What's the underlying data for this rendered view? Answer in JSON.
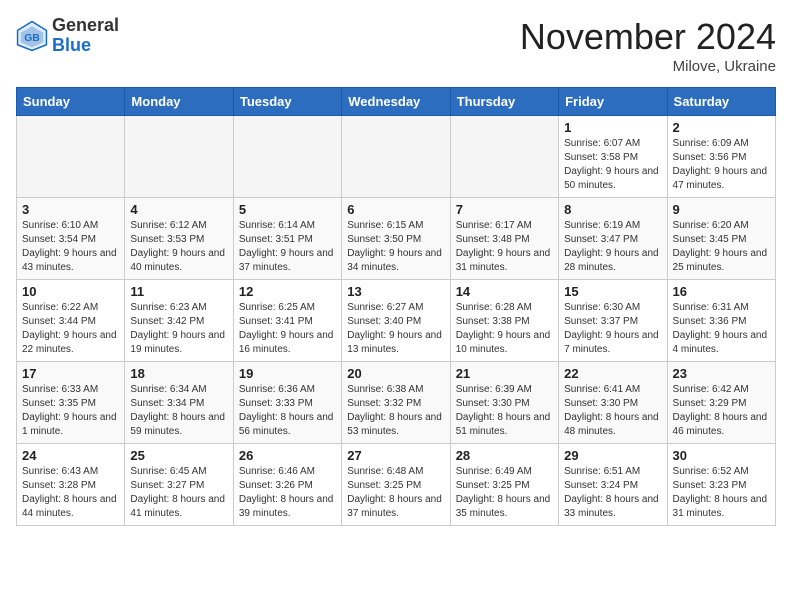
{
  "logo": {
    "general": "General",
    "blue": "Blue"
  },
  "title": "November 2024",
  "location": "Milove, Ukraine",
  "days_of_week": [
    "Sunday",
    "Monday",
    "Tuesday",
    "Wednesday",
    "Thursday",
    "Friday",
    "Saturday"
  ],
  "weeks": [
    [
      {
        "day": "",
        "info": ""
      },
      {
        "day": "",
        "info": ""
      },
      {
        "day": "",
        "info": ""
      },
      {
        "day": "",
        "info": ""
      },
      {
        "day": "",
        "info": ""
      },
      {
        "day": "1",
        "info": "Sunrise: 6:07 AM\nSunset: 3:58 PM\nDaylight: 9 hours and 50 minutes."
      },
      {
        "day": "2",
        "info": "Sunrise: 6:09 AM\nSunset: 3:56 PM\nDaylight: 9 hours and 47 minutes."
      }
    ],
    [
      {
        "day": "3",
        "info": "Sunrise: 6:10 AM\nSunset: 3:54 PM\nDaylight: 9 hours and 43 minutes."
      },
      {
        "day": "4",
        "info": "Sunrise: 6:12 AM\nSunset: 3:53 PM\nDaylight: 9 hours and 40 minutes."
      },
      {
        "day": "5",
        "info": "Sunrise: 6:14 AM\nSunset: 3:51 PM\nDaylight: 9 hours and 37 minutes."
      },
      {
        "day": "6",
        "info": "Sunrise: 6:15 AM\nSunset: 3:50 PM\nDaylight: 9 hours and 34 minutes."
      },
      {
        "day": "7",
        "info": "Sunrise: 6:17 AM\nSunset: 3:48 PM\nDaylight: 9 hours and 31 minutes."
      },
      {
        "day": "8",
        "info": "Sunrise: 6:19 AM\nSunset: 3:47 PM\nDaylight: 9 hours and 28 minutes."
      },
      {
        "day": "9",
        "info": "Sunrise: 6:20 AM\nSunset: 3:45 PM\nDaylight: 9 hours and 25 minutes."
      }
    ],
    [
      {
        "day": "10",
        "info": "Sunrise: 6:22 AM\nSunset: 3:44 PM\nDaylight: 9 hours and 22 minutes."
      },
      {
        "day": "11",
        "info": "Sunrise: 6:23 AM\nSunset: 3:42 PM\nDaylight: 9 hours and 19 minutes."
      },
      {
        "day": "12",
        "info": "Sunrise: 6:25 AM\nSunset: 3:41 PM\nDaylight: 9 hours and 16 minutes."
      },
      {
        "day": "13",
        "info": "Sunrise: 6:27 AM\nSunset: 3:40 PM\nDaylight: 9 hours and 13 minutes."
      },
      {
        "day": "14",
        "info": "Sunrise: 6:28 AM\nSunset: 3:38 PM\nDaylight: 9 hours and 10 minutes."
      },
      {
        "day": "15",
        "info": "Sunrise: 6:30 AM\nSunset: 3:37 PM\nDaylight: 9 hours and 7 minutes."
      },
      {
        "day": "16",
        "info": "Sunrise: 6:31 AM\nSunset: 3:36 PM\nDaylight: 9 hours and 4 minutes."
      }
    ],
    [
      {
        "day": "17",
        "info": "Sunrise: 6:33 AM\nSunset: 3:35 PM\nDaylight: 9 hours and 1 minute."
      },
      {
        "day": "18",
        "info": "Sunrise: 6:34 AM\nSunset: 3:34 PM\nDaylight: 8 hours and 59 minutes."
      },
      {
        "day": "19",
        "info": "Sunrise: 6:36 AM\nSunset: 3:33 PM\nDaylight: 8 hours and 56 minutes."
      },
      {
        "day": "20",
        "info": "Sunrise: 6:38 AM\nSunset: 3:32 PM\nDaylight: 8 hours and 53 minutes."
      },
      {
        "day": "21",
        "info": "Sunrise: 6:39 AM\nSunset: 3:30 PM\nDaylight: 8 hours and 51 minutes."
      },
      {
        "day": "22",
        "info": "Sunrise: 6:41 AM\nSunset: 3:30 PM\nDaylight: 8 hours and 48 minutes."
      },
      {
        "day": "23",
        "info": "Sunrise: 6:42 AM\nSunset: 3:29 PM\nDaylight: 8 hours and 46 minutes."
      }
    ],
    [
      {
        "day": "24",
        "info": "Sunrise: 6:43 AM\nSunset: 3:28 PM\nDaylight: 8 hours and 44 minutes."
      },
      {
        "day": "25",
        "info": "Sunrise: 6:45 AM\nSunset: 3:27 PM\nDaylight: 8 hours and 41 minutes."
      },
      {
        "day": "26",
        "info": "Sunrise: 6:46 AM\nSunset: 3:26 PM\nDaylight: 8 hours and 39 minutes."
      },
      {
        "day": "27",
        "info": "Sunrise: 6:48 AM\nSunset: 3:25 PM\nDaylight: 8 hours and 37 minutes."
      },
      {
        "day": "28",
        "info": "Sunrise: 6:49 AM\nSunset: 3:25 PM\nDaylight: 8 hours and 35 minutes."
      },
      {
        "day": "29",
        "info": "Sunrise: 6:51 AM\nSunset: 3:24 PM\nDaylight: 8 hours and 33 minutes."
      },
      {
        "day": "30",
        "info": "Sunrise: 6:52 AM\nSunset: 3:23 PM\nDaylight: 8 hours and 31 minutes."
      }
    ]
  ]
}
